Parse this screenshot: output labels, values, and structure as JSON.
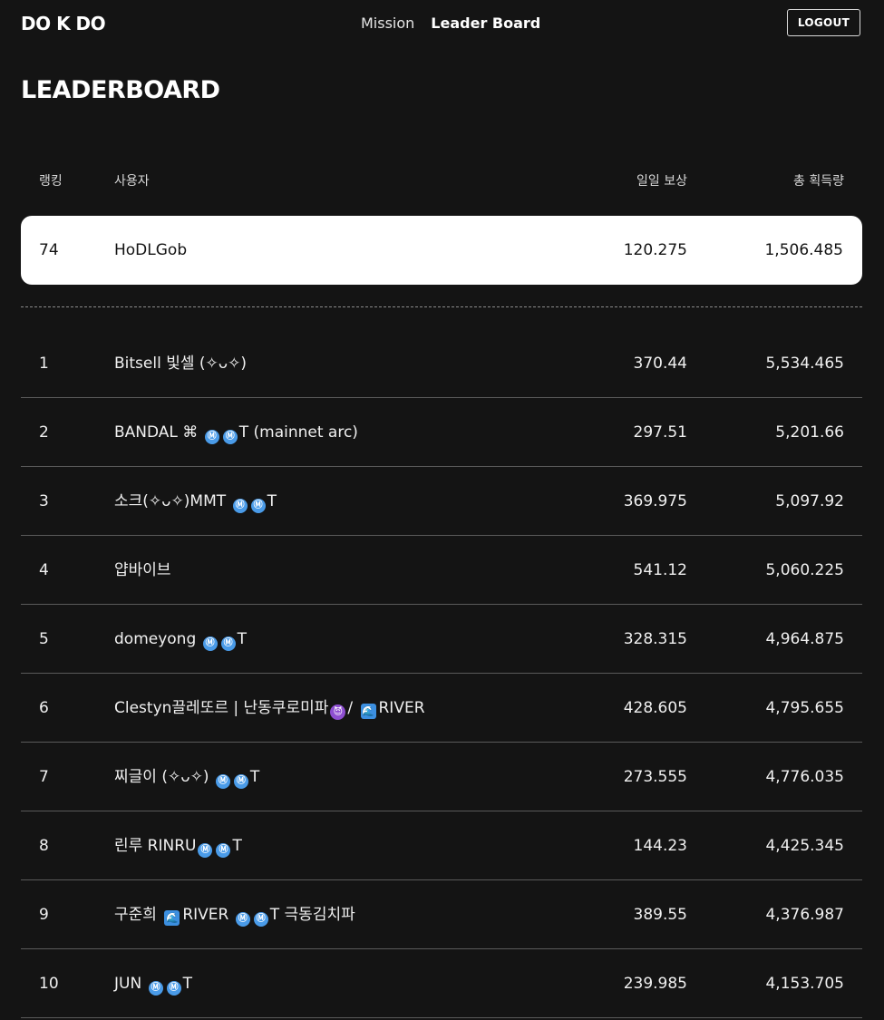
{
  "header": {
    "logo": "DO K DO",
    "nav": {
      "mission": "Mission",
      "leaderboard": "Leader Board"
    },
    "logout": "LOGOUT"
  },
  "page_title": "LEADERBOARD",
  "columns": {
    "rank": "랭킹",
    "user": "사용자",
    "daily": "일일 보상",
    "total": "총 획득량"
  },
  "my_row": {
    "rank": "74",
    "user": "HoDLGob",
    "daily": "120.275",
    "total": "1,506.485"
  },
  "icons": {
    "m": "Ⓜ",
    "wave": "🌊",
    "devil": "😈"
  },
  "rows": [
    {
      "rank": "1",
      "daily": "370.44",
      "total": "5,534.465",
      "user": {
        "name": "Bitsell 빛셀 (✧ᴗ✧)"
      }
    },
    {
      "rank": "2",
      "daily": "297.51",
      "total": "5,201.66",
      "user": {
        "pre": "BANDAL ⌘ ",
        "post": "T (mainnet arc)"
      }
    },
    {
      "rank": "3",
      "daily": "369.975",
      "total": "5,097.92",
      "user": {
        "pre": "소크(✧ᴗ✧)MMT ",
        "post": "T"
      }
    },
    {
      "rank": "4",
      "daily": "541.12",
      "total": "5,060.225",
      "user": {
        "name": "얍바이브"
      }
    },
    {
      "rank": "5",
      "daily": "328.315",
      "total": "4,964.875",
      "user": {
        "pre": "domeyong ",
        "post": "T"
      }
    },
    {
      "rank": "6",
      "daily": "428.605",
      "total": "4,795.655",
      "user": {
        "pre": "Clestyn끌레또르 | 난동쿠로미파",
        "mid": "/ ",
        "post": "RIVER"
      }
    },
    {
      "rank": "7",
      "daily": "273.555",
      "total": "4,776.035",
      "user": {
        "pre": "찌글이 (✧ᴗ✧) ",
        "post": "T"
      }
    },
    {
      "rank": "8",
      "daily": "144.23",
      "total": "4,425.345",
      "user": {
        "pre": "린루 RINRU",
        "post": "T"
      }
    },
    {
      "rank": "9",
      "daily": "389.55",
      "total": "4,376.987",
      "user": {
        "pre": "구준희 ",
        "mid": "RIVER ",
        "post": "T 극동김치파"
      }
    },
    {
      "rank": "10",
      "daily": "239.985",
      "total": "4,153.705",
      "user": {
        "pre": "JUN ",
        "post": "T"
      }
    }
  ]
}
